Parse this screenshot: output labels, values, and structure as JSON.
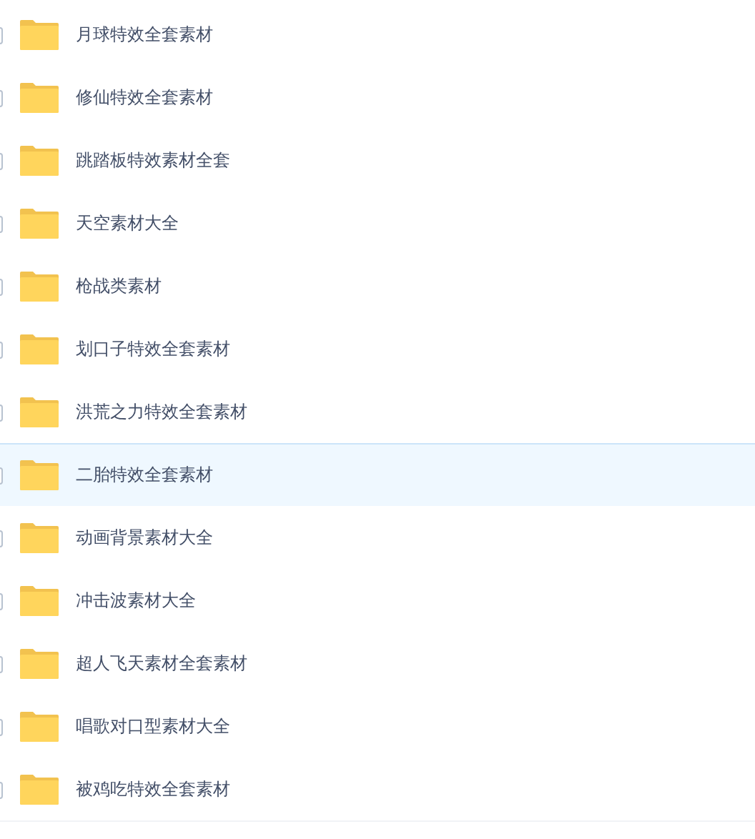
{
  "files": [
    {
      "name": "月球特效全套素材",
      "checked": false,
      "selected": false
    },
    {
      "name": "修仙特效全套素材",
      "checked": false,
      "selected": false
    },
    {
      "name": "跳踏板特效素材全套",
      "checked": false,
      "selected": false
    },
    {
      "name": "天空素材大全",
      "checked": false,
      "selected": false
    },
    {
      "name": "枪战类素材",
      "checked": false,
      "selected": false
    },
    {
      "name": "划口子特效全套素材",
      "checked": false,
      "selected": false
    },
    {
      "name": "洪荒之力特效全套素材",
      "checked": false,
      "selected": false
    },
    {
      "name": "二胎特效全套素材",
      "checked": false,
      "selected": true
    },
    {
      "name": "动画背景素材大全",
      "checked": false,
      "selected": false
    },
    {
      "name": "冲击波素材大全",
      "checked": false,
      "selected": false
    },
    {
      "name": "超人飞天素材全套素材",
      "checked": false,
      "selected": false
    },
    {
      "name": "唱歌对口型素材大全",
      "checked": false,
      "selected": false
    },
    {
      "name": "被鸡吃特效全套素材",
      "checked": false,
      "selected": false
    }
  ]
}
